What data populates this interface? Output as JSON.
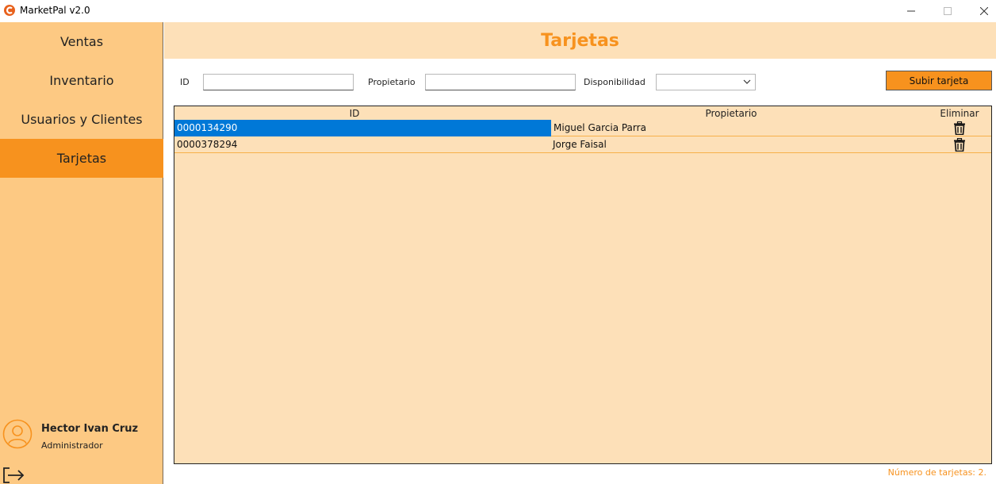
{
  "window": {
    "title": "MarketPal v2.0",
    "controls": [
      "minimize-icon",
      "maximize-icon",
      "close-icon"
    ]
  },
  "sidebar": {
    "items": [
      {
        "label": "Ventas",
        "active": false
      },
      {
        "label": "Inventario",
        "active": false
      },
      {
        "label": "Usuarios y Clientes",
        "active": false
      },
      {
        "label": "Tarjetas",
        "active": true
      }
    ],
    "user": {
      "name": "Hector Ivan Cruz",
      "role": "Administrador",
      "avatar_icon": "user-circle-icon"
    },
    "logout_icon": "logout-icon"
  },
  "header": {
    "title": "Tarjetas"
  },
  "filters": {
    "id_label": "ID",
    "id_value": "",
    "owner_label": "Propietario",
    "owner_value": "",
    "availability_label": "Disponibilidad",
    "availability_value": "",
    "upload_button": "Subir tarjeta"
  },
  "table": {
    "columns": [
      "ID",
      "Propietario",
      "Eliminar"
    ],
    "rows": [
      {
        "id": "0000134290",
        "owner": "Miguel Garcia Parra",
        "selected": true
      },
      {
        "id": "0000378294",
        "owner": "Jorge Faisal",
        "selected": false
      }
    ],
    "delete_icon": "trash-icon"
  },
  "footer": {
    "count_text": "Número de tarjetas: 2."
  },
  "colors": {
    "accent": "#f7921e",
    "sidebar_bg": "#fdc983",
    "panel_bg": "#fde0b8",
    "selection": "#0078d7"
  }
}
